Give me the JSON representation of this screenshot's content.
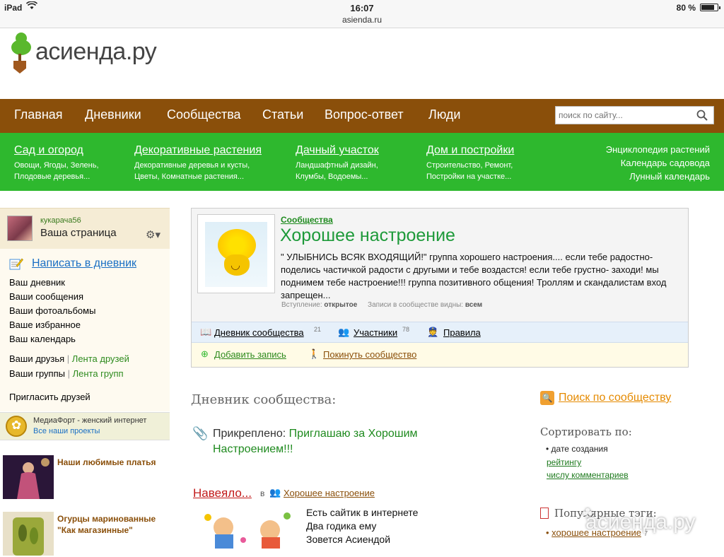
{
  "status_bar": {
    "device": "iPad",
    "time": "16:07",
    "url": "asienda.ru",
    "battery": "80 %"
  },
  "logo": {
    "text": "асиенда.ру"
  },
  "main_nav": {
    "items": [
      "Главная",
      "Дневники",
      "Сообщества",
      "Статьи",
      "Вопрос-ответ",
      "Люди"
    ],
    "search_placeholder": "поиск по сайту..."
  },
  "categories": [
    {
      "title": "Сад и огород",
      "sub1": "Овощи, Ягоды, Зелень,",
      "sub2": "Плодовые деревья..."
    },
    {
      "title": "Декоративные растения",
      "sub1": "Декоративные деревья и кусты,",
      "sub2": "Цветы, Комнатные растения..."
    },
    {
      "title": "Дачный участок",
      "sub1": "Ландшафтный дизайн,",
      "sub2": "Клумбы, Водоемы..."
    },
    {
      "title": "Дом и постройки",
      "sub1": "Строительство, Ремонт,",
      "sub2": "Постройки на участке..."
    }
  ],
  "category_links": [
    "Энциклопедия растений",
    "Календарь садовода",
    "Лунный календарь"
  ],
  "sidebar": {
    "username": "кукарача56",
    "my_page": "Ваша страница",
    "write_diary": "Написать в дневник",
    "menu": [
      "Ваш дневник",
      "Ваши сообщения",
      "Ваши фотоальбомы",
      "Ваше избранное",
      "Ваш календарь"
    ],
    "friends": "Ваши друзья",
    "friends_feed": "Лента друзей",
    "groups": "Ваши группы",
    "groups_feed": "Лента групп",
    "invite": "Пригласить друзей",
    "media_title": "МедиаФорт - женский интернет",
    "media_link": "Все наши проекты",
    "promos": [
      "Наши любимые платья",
      "Огурцы маринованные \"Как магазинные\""
    ]
  },
  "community": {
    "category": "Сообщества",
    "title": "Хорошее настроение",
    "description": "\" УЛЫБНИСЬ ВСЯК ВХОДЯЩИЙ!\" группа хорошего настроения.... если тебе радостно-поделись частичкой радости с другыми и тебе воздастся! если тебе грустно- заходи! мы поднимем тебе настроение!!! группа позитивного общения! Троллям и скандалистам вход запрещен...",
    "entry_label": "Вступление:",
    "entry_value": "открытое",
    "visibility_label": "Записи в сообществе видны:",
    "visibility_value": "всем",
    "diary_label": "Дневник сообщества",
    "diary_count": "21",
    "members_label": "Участники",
    "members_count": "78",
    "rules_label": "Правила",
    "add_post": "Добавить запись",
    "leave": "Покинуть сообщество"
  },
  "main": {
    "section_heading": "Дневник сообщества:",
    "pinned_label": "Прикреплено:",
    "pinned_link": "Приглашаю за Хорошим Настроением!!!",
    "post_title": "Навеяло...",
    "post_in": "в",
    "post_community": "Хорошее настроение",
    "post_lines": [
      "Есть сайтик в интернете",
      "Два годика ему",
      "Зовется Асиендой"
    ]
  },
  "right": {
    "search_community": "Поиск по сообществу",
    "sort_heading": "Сортировать по:",
    "sort_active": "• дате создания",
    "sort_links": [
      "рейтингу",
      "числу комментариев"
    ],
    "tags_heading": "Популярные тэги:",
    "tag": "хорошее настроение",
    "tag_count": "7"
  },
  "watermark": "асиенда.ру"
}
